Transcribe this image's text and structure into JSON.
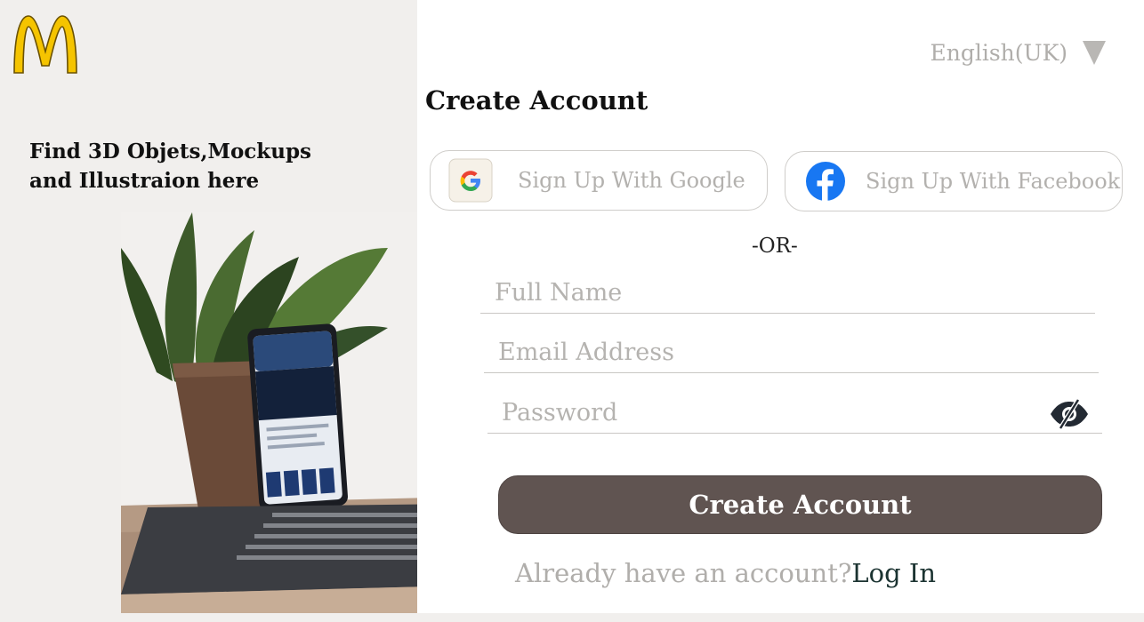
{
  "brand": {
    "logo_icon": "golden-arches-logo",
    "logo_color": "#f5c400"
  },
  "left": {
    "tagline_line1": "Find 3D Objets,Mockups",
    "tagline_line2": "and Illustraion here",
    "hero_image": "plant-phone-laptop-photo"
  },
  "language": {
    "label": "English(UK)",
    "icon": "caret-down-icon"
  },
  "form": {
    "title": "Create Account",
    "google_label": "Sign Up With Google",
    "facebook_label": "Sign Up With Facebook",
    "or_label": "-OR-",
    "fullname_placeholder": "Full Name",
    "email_placeholder": "Email Address",
    "password_placeholder": "Password",
    "password_toggle_icon": "eye-slash-icon",
    "submit_label": "Create Account",
    "login_prompt": "Already have an account?",
    "login_link": "Log In"
  },
  "colors": {
    "button_bg": "#605451",
    "facebook_blue": "#1877f2",
    "muted_text": "#b0aeab",
    "link": "#1b3331"
  }
}
